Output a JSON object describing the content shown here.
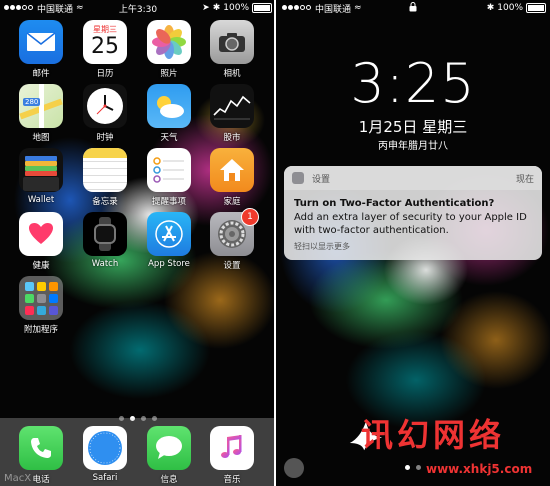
{
  "home": {
    "status": {
      "carrier": "中国联通",
      "time": "上午3:30",
      "battery": "100%"
    },
    "apps": [
      {
        "label": "邮件",
        "icon": "mail-icon"
      },
      {
        "label": "日历",
        "icon": "calendar-icon",
        "weekday": "星期三",
        "day": "25"
      },
      {
        "label": "照片",
        "icon": "photos-icon"
      },
      {
        "label": "相机",
        "icon": "camera-icon"
      },
      {
        "label": "地图",
        "icon": "maps-icon",
        "sign": "280"
      },
      {
        "label": "时钟",
        "icon": "clock-icon"
      },
      {
        "label": "天气",
        "icon": "weather-icon"
      },
      {
        "label": "股市",
        "icon": "stocks-icon"
      },
      {
        "label": "Wallet",
        "icon": "wallet-icon"
      },
      {
        "label": "备忘录",
        "icon": "notes-icon"
      },
      {
        "label": "提醒事项",
        "icon": "reminders-icon"
      },
      {
        "label": "家庭",
        "icon": "home-icon"
      },
      {
        "label": "健康",
        "icon": "health-icon"
      },
      {
        "label": "Watch",
        "icon": "watch-icon"
      },
      {
        "label": "App Store",
        "icon": "appstore-icon"
      },
      {
        "label": "设置",
        "icon": "settings-icon",
        "badge": "1"
      },
      {
        "label": "附加程序",
        "icon": "folder-icon"
      }
    ],
    "dock": [
      {
        "label": "电话",
        "icon": "phone-icon"
      },
      {
        "label": "Safari",
        "icon": "safari-icon"
      },
      {
        "label": "信息",
        "icon": "messages-icon"
      },
      {
        "label": "音乐",
        "icon": "music-icon"
      }
    ],
    "watermark": "MacX"
  },
  "lock": {
    "status": {
      "carrier": "中国联通",
      "battery": "100%"
    },
    "time": "3:25",
    "date": "1月25日 星期三",
    "lunar": "丙申年腊月廿八",
    "notification": {
      "app": "设置",
      "when": "现在",
      "title": "Turn on Two-Factor Authentication?",
      "body": "Add an extra layer of security to your Apple ID with two-factor authentication.",
      "hint": "轻扫以显示更多"
    },
    "watermark": {
      "title": "讯幻网络",
      "url": "www.xhkj5.com"
    }
  },
  "colors": {
    "badge": "#ef3a2c",
    "watermark": "#e33333"
  }
}
